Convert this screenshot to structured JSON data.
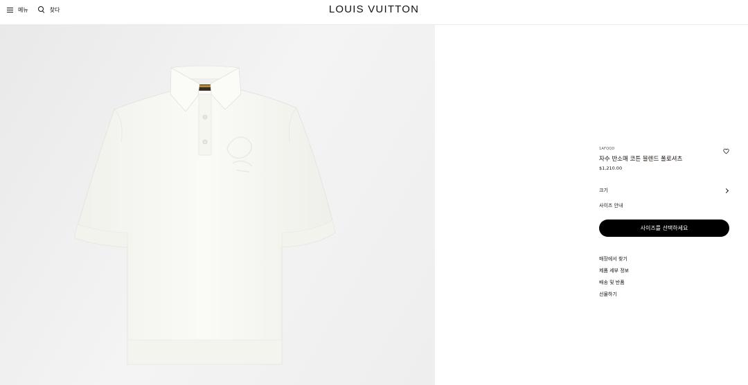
{
  "header": {
    "menu_label": "메뉴",
    "search_label": "찾다",
    "brand": "LOUIS VUITTON"
  },
  "product": {
    "sku": "1AFQQD",
    "title": "자수 반소매 코튼 블렌드 폴로셔츠",
    "price": "$1,210.00",
    "size_label": "크기",
    "size_guide": "사이즈 안내",
    "cta_label": "사이즈를 선택하세요",
    "links": [
      "매장에서 찾기",
      "제품 세부 정보",
      "배송 및 반품",
      "선물하기"
    ]
  },
  "image": {
    "subject": "white-polo-shirt",
    "background_color": "#ededed",
    "shirt_color": "#f7f7f2"
  },
  "colors": {
    "text": "#19110b",
    "cta_background": "#000000",
    "cta_text": "#ffffff"
  }
}
